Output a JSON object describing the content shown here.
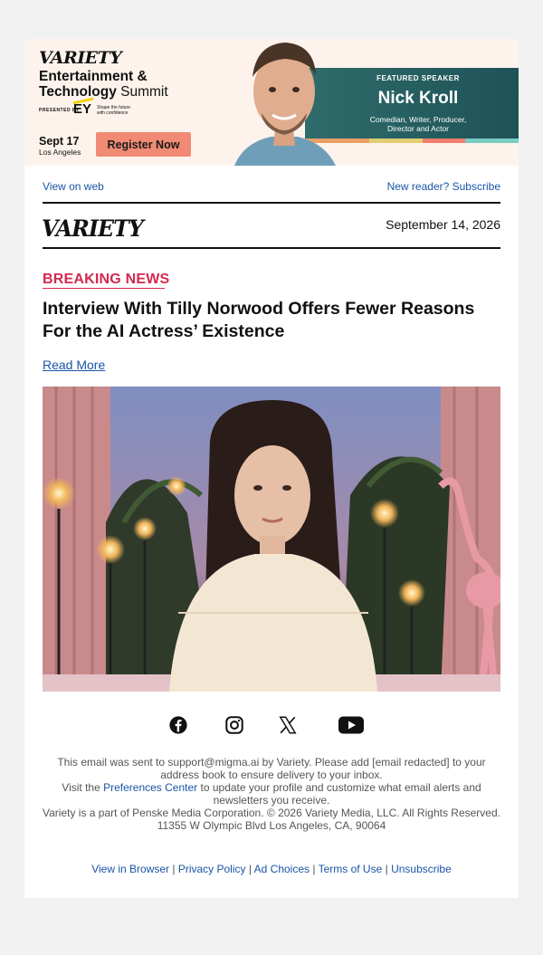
{
  "banner": {
    "logo": "VARIETY",
    "title_line1": "Entertainment &",
    "title_line2_bold": "Technology",
    "title_line2_light": " Summit",
    "presented_by": "PRESENTED BY",
    "sponsor": "EY",
    "sponsor_tagline": "Shape the future with confidence",
    "event_date": "Sept 17",
    "event_city": "Los Angeles",
    "register_label": "Register Now",
    "featured_label": "FEATURED SPEAKER",
    "speaker_name": "Nick Kroll",
    "speaker_role_line1": "Comedian, Writer, Producer,",
    "speaker_role_line2": "Director and Actor"
  },
  "header": {
    "view_on_web": "View on web",
    "subscribe": "New reader? Subscribe",
    "logo": "VARIETY",
    "date": "September 14, 2026"
  },
  "article": {
    "kicker": "BREAKING NEWS",
    "headline": "Interview With Tilly Norwood Offers Fewer Reasons For the AI Actress’ Existence",
    "read_more": "Read More"
  },
  "social": [
    "facebook-icon",
    "instagram-icon",
    "x-icon",
    "youtube-icon"
  ],
  "footer": {
    "line1": "This email was sent to support@migma.ai by Variety. Please add [email redacted] to your address book to ensure delivery to your inbox.",
    "line2_prefix": "Visit the ",
    "line2_link": "Preferences Center",
    "line2_suffix": " to update your profile and customize what email alerts and newsletters you receive.",
    "line3": "Variety is a part of Penske Media Corporation. © 2026 Variety Media, LLC. All Rights Reserved.",
    "line4": "11355 W Olympic Blvd Los Angeles, CA, 90064",
    "links": [
      "View in Browser",
      "Privacy Policy",
      "Ad Choices",
      "Terms of Use",
      "Unsubscribe"
    ],
    "separator": " | "
  },
  "colors": {
    "accent_red": "#d3294f",
    "link_blue": "#1a54a6",
    "register_button": "#f08a74",
    "speaker_panel": "#2f6c6b"
  }
}
